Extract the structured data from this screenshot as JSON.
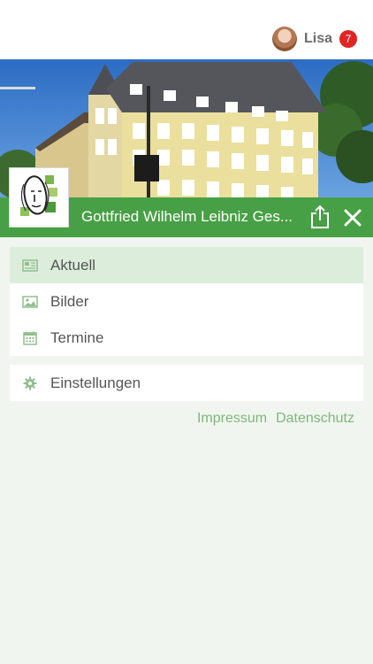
{
  "user": {
    "name": "Lisa",
    "notifications": "7"
  },
  "school": {
    "title": "Gottfried Wilhelm Leibniz Ges..."
  },
  "menu": {
    "items": [
      {
        "label": "Aktuell",
        "icon": "newspaper-icon",
        "active": true
      },
      {
        "label": "Bilder",
        "icon": "image-icon",
        "active": false
      },
      {
        "label": "Termine",
        "icon": "calendar-icon",
        "active": false
      }
    ],
    "settings": {
      "label": "Einstellungen",
      "icon": "gear-icon"
    }
  },
  "footer": {
    "impressum": "Impressum",
    "datenschutz": "Datenschutz"
  },
  "colors": {
    "brand_green": "#47a045",
    "accent_light": "#dceedb",
    "badge_red": "#e02424",
    "background": "#f0f6ef"
  }
}
